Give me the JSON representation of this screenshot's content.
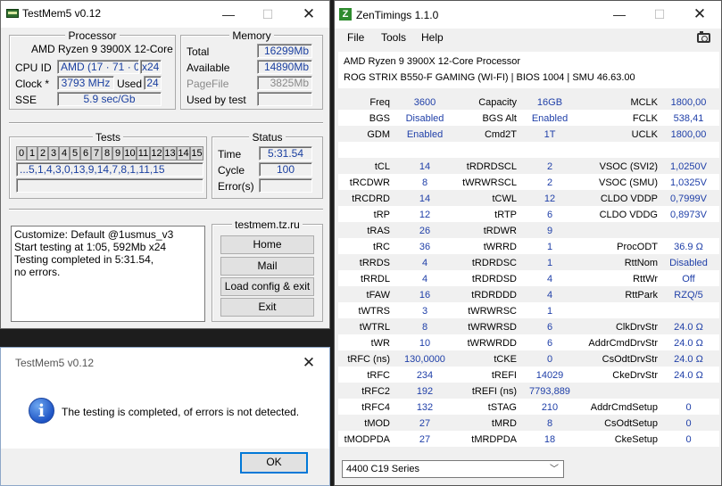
{
  "testmem": {
    "title": "TestMem5 v0.12",
    "processor": {
      "group_label": "Processor",
      "cpu_name": "AMD Ryzen 9 3900X 12-Core",
      "cpu_id_label": "CPU ID",
      "cpu_id_value": "AMD  (17 · 71 · 0)",
      "cpu_threads": "x24",
      "clock_label": "Clock *",
      "clock_value": "3793 MHz",
      "used_label": "Used",
      "used_value": "24",
      "sse_label": "SSE",
      "sse_value": "5.9 sec/Gb"
    },
    "memory": {
      "group_label": "Memory",
      "total_label": "Total",
      "total_value": "16299Mb",
      "available_label": "Available",
      "available_value": "14890Mb",
      "pagefile_label": "PageFile",
      "pagefile_value": "3825Mb",
      "used_by_test_label": "Used by test",
      "used_by_test_value": ""
    },
    "tests": {
      "group_label": "Tests",
      "cells": [
        "0",
        "1",
        "2",
        "3",
        "4",
        "5",
        "6",
        "7",
        "8",
        "9",
        "10",
        "11",
        "12",
        "13",
        "14",
        "15"
      ],
      "sequence": "...5,1,4,3,0,13,9,14,7,8,1,11,15",
      "progress": ""
    },
    "status": {
      "group_label": "Status",
      "time_label": "Time",
      "time_value": "5:31.54",
      "cycle_label": "Cycle",
      "cycle_value": "100",
      "errors_label": "Error(s)",
      "errors_value": ""
    },
    "log": [
      "Customize: Default @1usmus_v3",
      "Start testing at 1:05, 592Mb x24",
      "Testing completed in 5:31.54,",
      "no errors."
    ],
    "site": "testmem.tz.ru",
    "buttons": {
      "home": "Home",
      "mail": "Mail",
      "load_config": "Load config & exit",
      "exit": "Exit"
    }
  },
  "message": {
    "title": "TestMem5 v0.12",
    "text": "The testing is completed, of errors is not detected.",
    "ok": "OK"
  },
  "zentimings": {
    "title": "ZenTimings 1.1.0",
    "icon_letter": "Z",
    "menu": {
      "file": "File",
      "tools": "Tools",
      "help": "Help"
    },
    "cpu": "AMD Ryzen 9 3900X 12-Core Processor",
    "board": "ROG STRIX B550-F GAMING (WI-FI) | BIOS 1004 | SMU 46.63.00",
    "rows": [
      {
        "l1": "Freq",
        "v1": "3600",
        "l2": "Capacity",
        "v2": "16GB",
        "l3": "MCLK",
        "v3": "1800,00"
      },
      {
        "l1": "BGS",
        "v1": "Disabled",
        "l2": "BGS Alt",
        "v2": "Enabled",
        "l3": "FCLK",
        "v3": "538,41"
      },
      {
        "l1": "GDM",
        "v1": "Enabled",
        "l2": "Cmd2T",
        "v2": "1T",
        "l3": "UCLK",
        "v3": "1800,00"
      },
      {
        "l1": "",
        "v1": "",
        "l2": "",
        "v2": "",
        "l3": "",
        "v3": ""
      },
      {
        "l1": "tCL",
        "v1": "14",
        "l2": "tRDRDSCL",
        "v2": "2",
        "l3": "VSOC (SVI2)",
        "v3": "1,0250V"
      },
      {
        "l1": "tRCDWR",
        "v1": "8",
        "l2": "tWRWRSCL",
        "v2": "2",
        "l3": "VSOC (SMU)",
        "v3": "1,0325V"
      },
      {
        "l1": "tRCDRD",
        "v1": "14",
        "l2": "tCWL",
        "v2": "12",
        "l3": "CLDO VDDP",
        "v3": "0,7999V"
      },
      {
        "l1": "tRP",
        "v1": "12",
        "l2": "tRTP",
        "v2": "6",
        "l3": "CLDO VDDG",
        "v3": "0,8973V"
      },
      {
        "l1": "tRAS",
        "v1": "26",
        "l2": "tRDWR",
        "v2": "9",
        "l3": "",
        "v3": ""
      },
      {
        "l1": "tRC",
        "v1": "36",
        "l2": "tWRRD",
        "v2": "1",
        "l3": "ProcODT",
        "v3": "36.9 Ω"
      },
      {
        "l1": "tRRDS",
        "v1": "4",
        "l2": "tRDRDSC",
        "v2": "1",
        "l3": "RttNom",
        "v3": "Disabled"
      },
      {
        "l1": "tRRDL",
        "v1": "4",
        "l2": "tRDRDSD",
        "v2": "4",
        "l3": "RttWr",
        "v3": "Off"
      },
      {
        "l1": "tFAW",
        "v1": "16",
        "l2": "tRDRDDD",
        "v2": "4",
        "l3": "RttPark",
        "v3": "RZQ/5"
      },
      {
        "l1": "tWTRS",
        "v1": "3",
        "l2": "tWRWRSC",
        "v2": "1",
        "l3": "",
        "v3": ""
      },
      {
        "l1": "tWTRL",
        "v1": "8",
        "l2": "tWRWRSD",
        "v2": "6",
        "l3": "ClkDrvStr",
        "v3": "24.0 Ω"
      },
      {
        "l1": "tWR",
        "v1": "10",
        "l2": "tWRWRDD",
        "v2": "6",
        "l3": "AddrCmdDrvStr",
        "v3": "24.0 Ω"
      },
      {
        "l1": "tRFC (ns)",
        "v1": "130,0000",
        "l2": "tCKE",
        "v2": "0",
        "l3": "CsOdtDrvStr",
        "v3": "24.0 Ω"
      },
      {
        "l1": "tRFC",
        "v1": "234",
        "l2": "tREFI",
        "v2": "14029",
        "l3": "CkeDrvStr",
        "v3": "24.0 Ω"
      },
      {
        "l1": "tRFC2",
        "v1": "192",
        "l2": "tREFI (ns)",
        "v2": "7793,889",
        "l3": "",
        "v3": ""
      },
      {
        "l1": "tRFC4",
        "v1": "132",
        "l2": "tSTAG",
        "v2": "210",
        "l3": "AddrCmdSetup",
        "v3": "0"
      },
      {
        "l1": "tMOD",
        "v1": "27",
        "l2": "tMRD",
        "v2": "8",
        "l3": "CsOdtSetup",
        "v3": "0"
      },
      {
        "l1": "tMODPDA",
        "v1": "27",
        "l2": "tMRDPDA",
        "v2": "18",
        "l3": "CkeSetup",
        "v3": "0"
      }
    ],
    "preset": "4400 C19 Series"
  }
}
